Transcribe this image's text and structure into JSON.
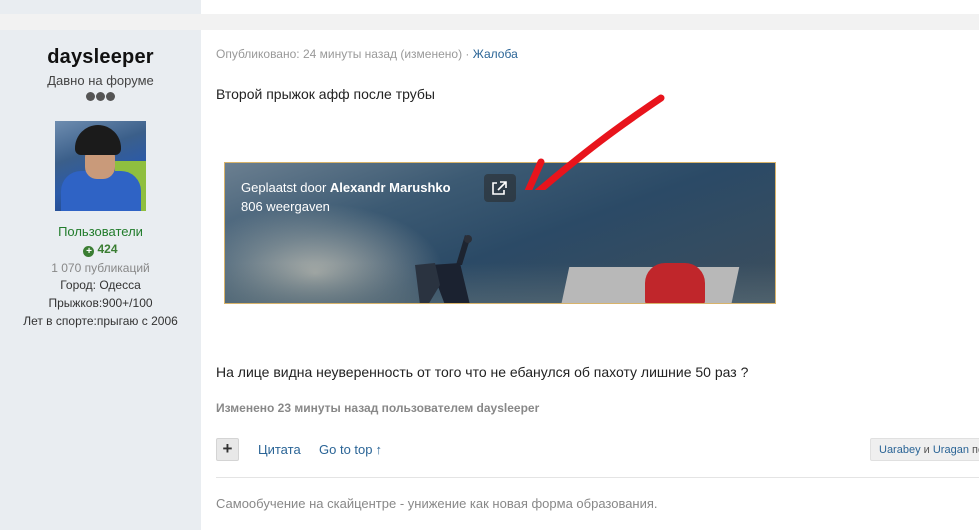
{
  "author": {
    "name": "daysleeper",
    "title": "Давно на форуме",
    "group": "Пользователи",
    "reputation": "424",
    "posts": "1 070 публикаций",
    "city": "Город: Одесса",
    "jumps": "Прыжков:900+/100",
    "years": "Лет в спорте:прыгаю с 2006"
  },
  "post": {
    "published": "Опубликовано: 24 минуты назад (изменено)",
    "separator": "·",
    "report": "Жалоба",
    "text1": "Второй прыжок афф после трубы",
    "text2": "На лице видна неуверенность от того что не ебанулся об пахоту лишние 50 раз ?",
    "edited": "Изменено 23 минуты назад пользователем daysleeper"
  },
  "video": {
    "posted_prefix": "Geplaatst door",
    "posted_author": "Alexandr Marushko",
    "views": "806 weergaven"
  },
  "actions": {
    "plus": "+",
    "quote": "Цитата",
    "go_top": "Go to top",
    "go_top_icon": "↑",
    "likes_user1": "Uarabey",
    "likes_and": "и",
    "likes_user2": "Uragan",
    "likes_suffix": "по"
  },
  "signature": "Самообучение на скайцентре - унижение как новая форма образования.",
  "colors": {
    "link": "#2a6496",
    "group": "#217c2b",
    "arrow": "#e8141c"
  }
}
